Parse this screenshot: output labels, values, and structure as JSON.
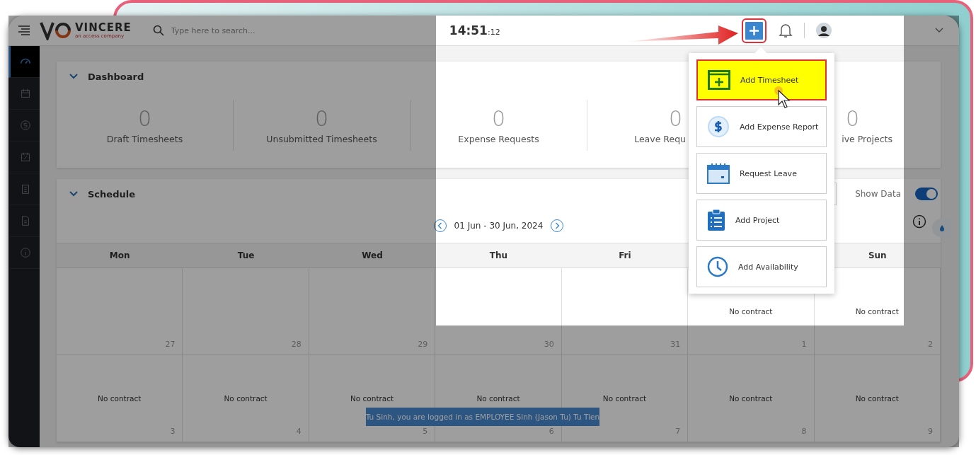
{
  "header": {
    "logo": {
      "name": "VINCERE",
      "tagline": "an access company"
    },
    "search": {
      "placeholder": "Type here to search..."
    },
    "clock": {
      "time": "14:51",
      "seconds": ":12"
    }
  },
  "sidebar": {
    "items": [
      {
        "selected": true
      },
      {
        "selected": false
      },
      {
        "selected": false
      },
      {
        "selected": false
      },
      {
        "selected": false
      },
      {
        "selected": false
      },
      {
        "selected": false
      }
    ]
  },
  "dashboard": {
    "title": "Dashboard",
    "stats": [
      {
        "value": "0",
        "label": "Draft Timesheets"
      },
      {
        "value": "0",
        "label": "Unsubmitted Timesheets"
      },
      {
        "value": "0",
        "label": "Expense Requests"
      },
      {
        "value": "0",
        "label": "Leave Requ"
      },
      {
        "value": "0",
        "label": "ive Projects"
      }
    ]
  },
  "schedule": {
    "title": "Schedule",
    "show_data": {
      "label": "Show Data",
      "on": true
    },
    "range": "01 Jun - 30 Jun, 2024",
    "days": [
      {
        "label": "Mon"
      },
      {
        "label": "Tue"
      },
      {
        "label": "Wed"
      },
      {
        "label": "Thu"
      },
      {
        "label": "Fri"
      },
      {
        "label": "Sun"
      }
    ],
    "weeks": [
      [
        {
          "date": "27"
        },
        {
          "date": "28"
        },
        {
          "date": "29"
        },
        {
          "date": "30"
        },
        {
          "date": "31"
        },
        {
          "date": "1",
          "note": "No contract"
        },
        {
          "date": "2",
          "note": "No contract"
        }
      ],
      [
        {
          "date": "3",
          "note": "No contract"
        },
        {
          "date": "4",
          "note": "No contract"
        },
        {
          "date": "5",
          "note": "No contract"
        },
        {
          "date": "6",
          "note": "No contract"
        },
        {
          "date": "7",
          "note": "No contract"
        },
        {
          "date": "8",
          "note": "No contract"
        },
        {
          "date": "9",
          "note": "No contract"
        }
      ]
    ]
  },
  "add_menu": {
    "open": true,
    "items": [
      {
        "kind": "timesheet",
        "label": "Add Timesheet",
        "highlighted": true
      },
      {
        "kind": "expense",
        "label": "Add Expense Report",
        "highlighted": false
      },
      {
        "kind": "leave",
        "label": "Request Leave",
        "highlighted": false
      },
      {
        "kind": "project",
        "label": "Add Project",
        "highlighted": false
      },
      {
        "kind": "availability",
        "label": "Add Availability",
        "highlighted": false
      }
    ]
  },
  "toast": "Tu Sinh, you are logged in as EMPLOYEE Sinh (Jason Tu) Tu Tien"
}
